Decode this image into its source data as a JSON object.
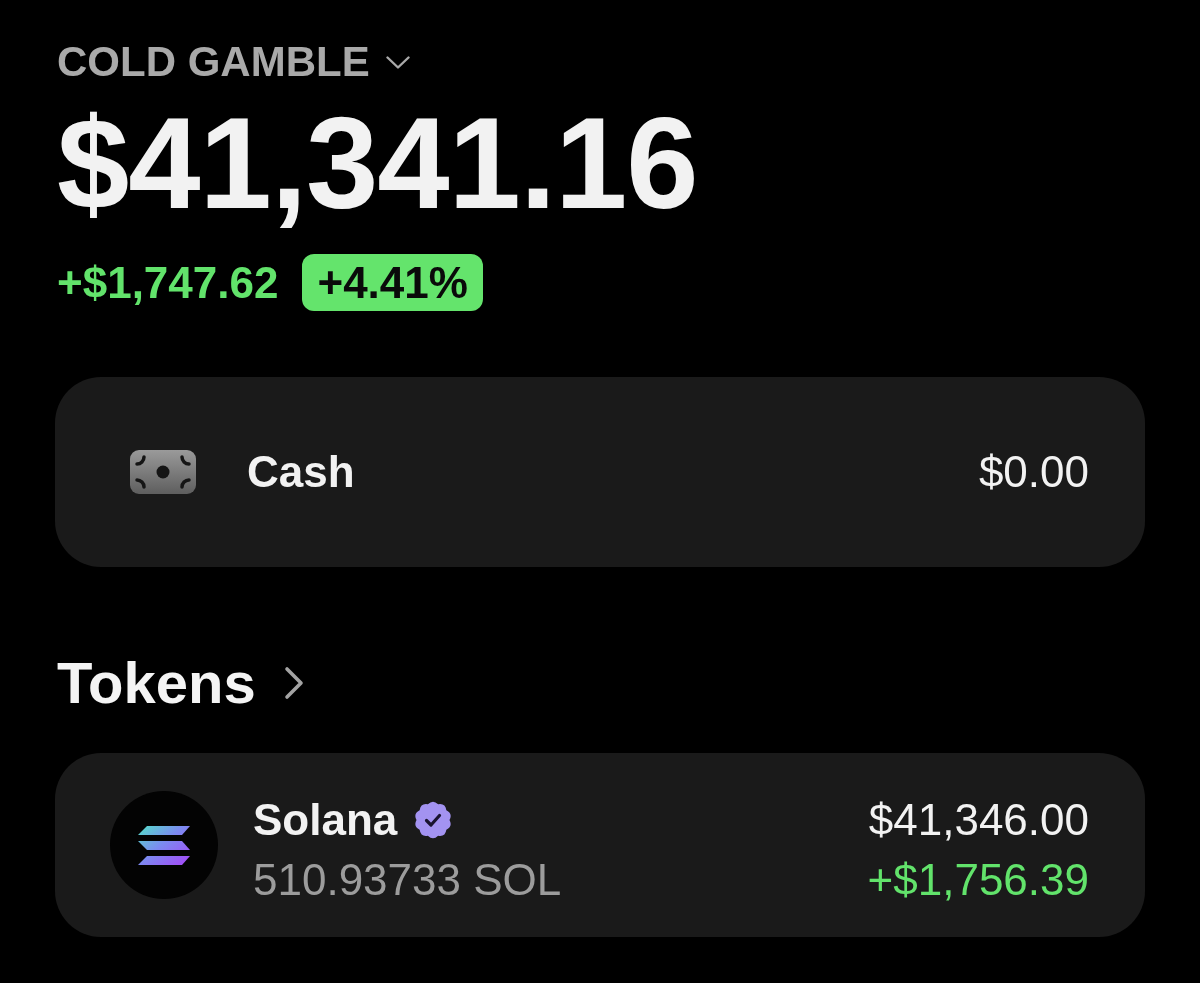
{
  "account": {
    "name": "COLD GAMBLE"
  },
  "balance": {
    "total": "$41,341.16",
    "change": "+$1,747.62",
    "change_percent": "+4.41%"
  },
  "cash": {
    "label": "Cash",
    "value": "$0.00"
  },
  "tokens": {
    "title": "Tokens",
    "items": [
      {
        "name": "Solana",
        "verified": true,
        "amount": "510.93733 SOL",
        "value": "$41,346.00",
        "change": "+$1,756.39"
      }
    ]
  }
}
